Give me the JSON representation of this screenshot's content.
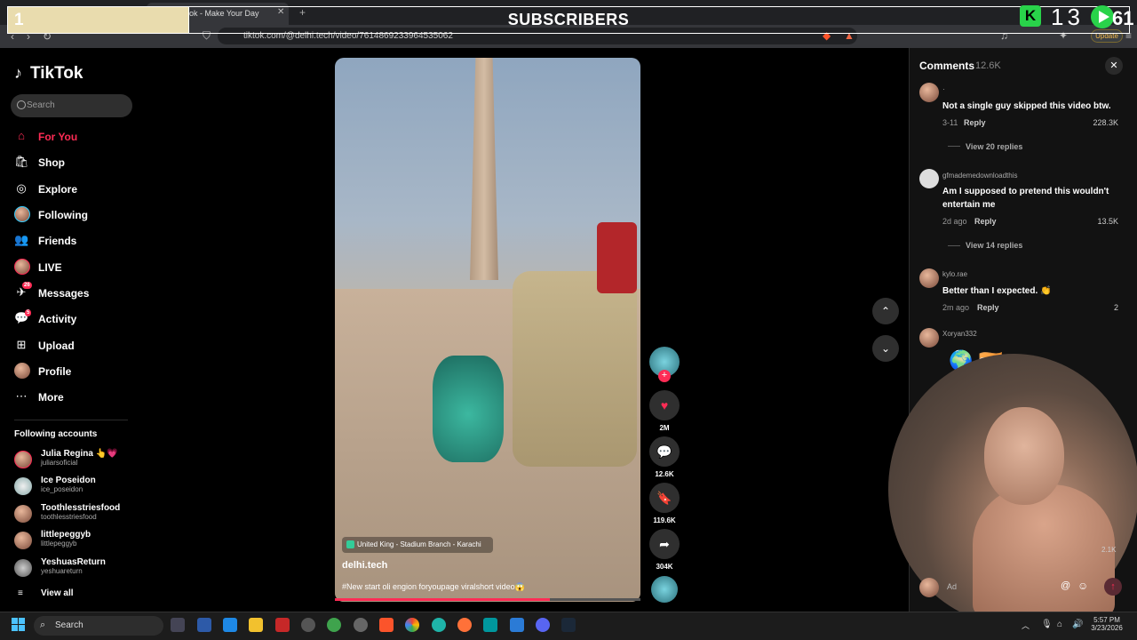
{
  "overlay": {
    "number": "1",
    "title": "SUBSCRIBERS",
    "kick_count": "13",
    "play_count": "61"
  },
  "browser": {
    "tab_title": "ok - Make Your Day",
    "url": "tiktok.com/@delhi.tech/video/7614869233964535062",
    "update_label": "Update"
  },
  "sidebar": {
    "logo": "TikTok",
    "search_placeholder": "Search",
    "nav": [
      {
        "label": "For You",
        "icon": "home-icon",
        "color": "#fe2c55"
      },
      {
        "label": "Shop",
        "icon": "shop-icon"
      },
      {
        "label": "Explore",
        "icon": "compass-icon"
      },
      {
        "label": "Following",
        "icon": "following-avatar"
      },
      {
        "label": "Friends",
        "icon": "friends-icon"
      },
      {
        "label": "LIVE",
        "icon": "live-icon"
      },
      {
        "label": "Messages",
        "icon": "messages-icon",
        "badge": "26"
      },
      {
        "label": "Activity",
        "icon": "activity-icon",
        "badge": "5"
      },
      {
        "label": "Upload",
        "icon": "upload-icon"
      },
      {
        "label": "Profile",
        "icon": "profile-avatar"
      },
      {
        "label": "More",
        "icon": "more-icon"
      }
    ],
    "following_title": "Following accounts",
    "accounts": [
      {
        "name": "Julia Regina 👆💗",
        "handle": "juliarsoficial"
      },
      {
        "name": "Ice Poseidon",
        "handle": "ice_poseidon"
      },
      {
        "name": "Toothlesstriesfood",
        "handle": "toothlesstriesfood"
      },
      {
        "name": "littlepeggyb",
        "handle": "littlepeggyb"
      },
      {
        "name": "YeshuasReturn",
        "handle": "yeshuareturn"
      }
    ],
    "view_all": "View all"
  },
  "video": {
    "location": "United King - Stadium Branch - Karachi",
    "username": "delhi.tech",
    "caption": "#New start oli engion foryoupage viralshort video😱",
    "progress": 0.7
  },
  "actions": {
    "likes": "2M",
    "comments": "12.6K",
    "saves": "119.6K",
    "shares": "304K"
  },
  "comments": {
    "title": "Comments",
    "count": "12.6K",
    "items": [
      {
        "user": "·",
        "text": "Not a single guy skipped this video btw.",
        "date": "3-11",
        "reply": "Reply",
        "likes": "228.3K",
        "view_replies": "View 20 replies"
      },
      {
        "user": "gfmademedownloadthis",
        "text": "Am I supposed to pretend this wouldn't entertain me",
        "date": "2d ago",
        "reply": "Reply",
        "likes": "13.5K",
        "view_replies": "View 14 replies"
      },
      {
        "user": "kylo.rae",
        "text": "Better than I expected. 👏",
        "date": "2m ago",
        "reply": "Reply",
        "likes": "2"
      },
      {
        "user": "Xoryan332",
        "text": "🌍 🇮🇳"
      }
    ],
    "partial_like": "2.1K",
    "input_placeholder": "Ad"
  },
  "taskbar": {
    "search": "Search",
    "time": "5:57 PM",
    "date": "3/23/2026"
  }
}
